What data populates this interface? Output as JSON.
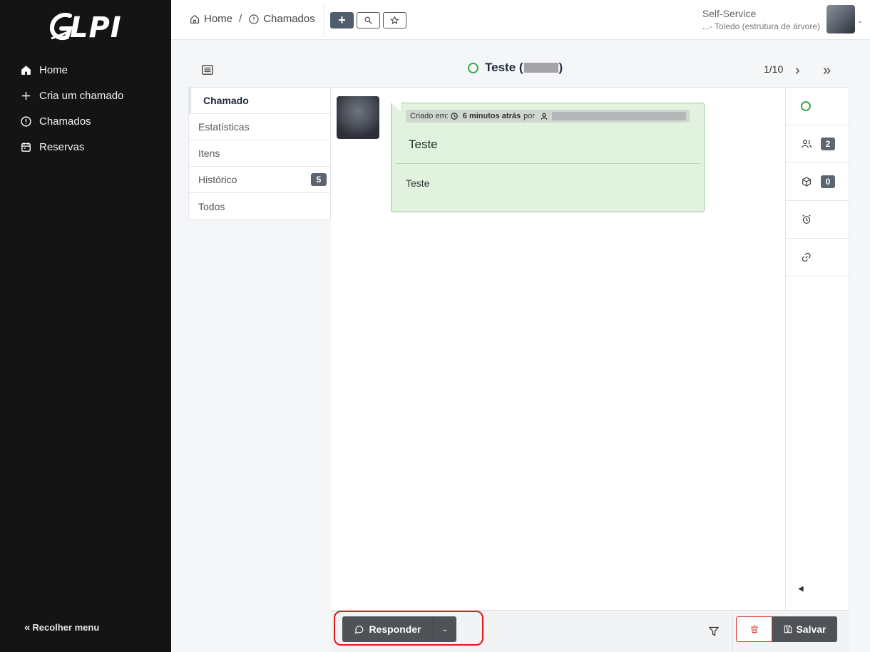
{
  "brand": {
    "logo_text": "LPI"
  },
  "sidebar": {
    "items": [
      {
        "label": "Home",
        "icon": "home-icon"
      },
      {
        "label": "Cria um chamado",
        "icon": "plus-icon"
      },
      {
        "label": "Chamados",
        "icon": "alert-circle-icon"
      },
      {
        "label": "Reservas",
        "icon": "calendar-icon"
      }
    ],
    "collapse_label": "Recolher menu"
  },
  "topbar": {
    "breadcrumb": {
      "home": "Home",
      "separator": "/",
      "section": "Chamados"
    },
    "add_label": "+",
    "profile": {
      "name": "Self-Service",
      "entity": "...- Toledo (estrutura de árvore)"
    }
  },
  "ticket": {
    "title_prefix": "Teste (",
    "title_suffix": ")",
    "pager": "1/10",
    "status_color": "#3aa84a"
  },
  "tabs": [
    {
      "label": "Chamado",
      "active": true
    },
    {
      "label": "Estatísticas"
    },
    {
      "label": "Itens"
    },
    {
      "label": "Histórico",
      "badge": "5"
    },
    {
      "label": "Todos"
    }
  ],
  "timeline": {
    "meta_created": "Criado em:",
    "meta_time": "6 minutos atrás",
    "meta_by": "por",
    "post_title": "Teste",
    "post_body": "Teste"
  },
  "right_panel": {
    "actors_count": "2",
    "items_count": "0"
  },
  "footer": {
    "reply_label": "Responder",
    "save_label": "Salvar"
  }
}
